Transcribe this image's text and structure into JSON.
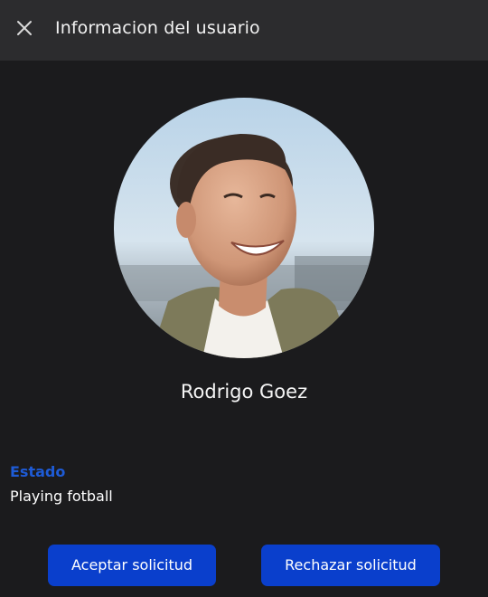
{
  "header": {
    "title": "Informacion del usuario",
    "close_icon": "close-icon"
  },
  "profile": {
    "name": "Rodrigo Goez",
    "status_label": "Estado",
    "status_value": "Playing fotball"
  },
  "actions": {
    "accept_label": "Aceptar solicitud",
    "reject_label": "Rechazar solicitud"
  },
  "colors": {
    "background": "#1b1b1d",
    "header_background": "#2c2c2e",
    "accent": "#1e5bd6",
    "button": "#0a3fcc"
  }
}
